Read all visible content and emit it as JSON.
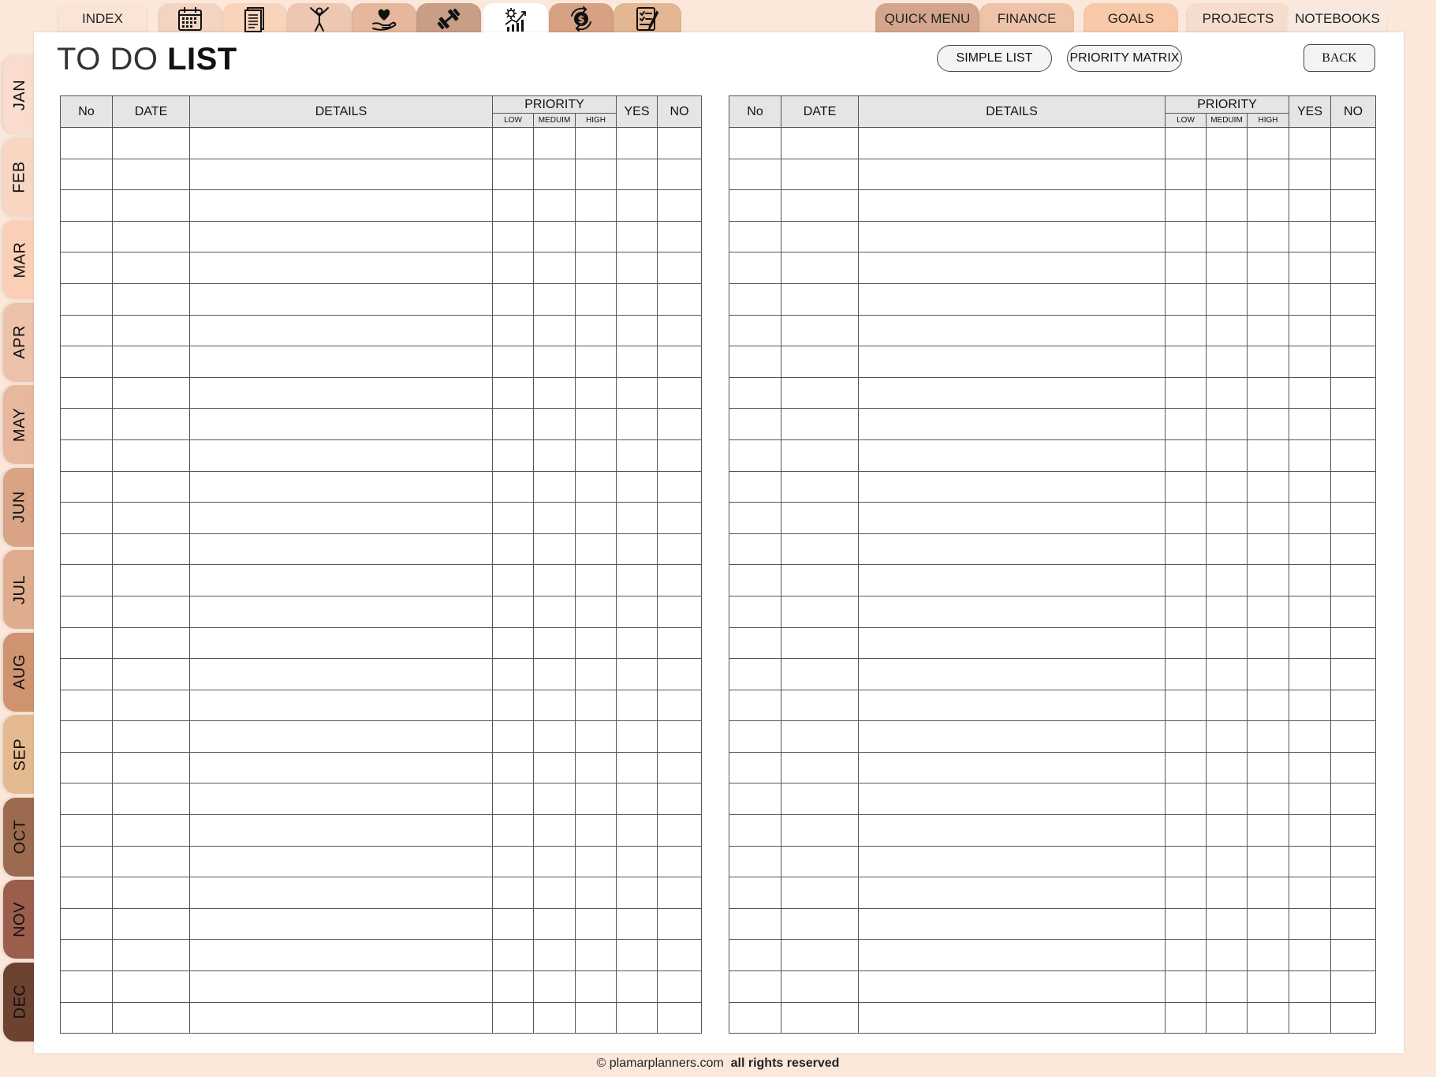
{
  "top_tabs": {
    "index": "INDEX",
    "icons": [
      "calendar-icon",
      "document-icon",
      "person-raising-arms-icon",
      "heart-hand-icon",
      "dumbbell-icon",
      "growth-gear-chart-icon",
      "money-exchange-icon",
      "checklist-icon"
    ],
    "right": {
      "quick_menu": "QUICK MENU",
      "finance": "FINANCE",
      "goals": "GOALS",
      "projects": "PROJECTS",
      "notebooks": "NOTEBOOKS"
    }
  },
  "months": [
    "JAN",
    "FEB",
    "MAR",
    "APR",
    "MAY",
    "JUN",
    "JUL",
    "AUG",
    "SEP",
    "OCT",
    "NOV",
    "DEC"
  ],
  "colors": {
    "months": [
      "#f9dccd",
      "#f8d6c2",
      "#fbcfb5",
      "#edc1aa",
      "#e8b89e",
      "#d9a386",
      "#dfac8d",
      "#cf9370",
      "#e4b98f",
      "#9c6a4f",
      "#9b5e4d",
      "#6e4230"
    ],
    "tabs": [
      "#fae4d6",
      "#f3d4c2",
      "#fad3bb",
      "#edc7b1",
      "#e5b89d",
      "#c99e86",
      "#ffffff",
      "#d6a283",
      "#e3b792"
    ],
    "right_tabs": [
      "#d4a58c",
      "#eec3a8",
      "#f8c9a9",
      "#f5dccd",
      "#f7e9e0"
    ]
  },
  "title": {
    "light": "TO DO ",
    "bold": "LIST"
  },
  "buttons": {
    "simple_list": "SIMPLE LIST",
    "priority_matrix": "PRIORITY MATRIX",
    "back": "BACK"
  },
  "table": {
    "headers": {
      "no": "No",
      "date": "DATE",
      "details": "DETAILS",
      "priority": "PRIORITY",
      "yes": "YES",
      "no_col": "NO"
    },
    "priority_levels": {
      "low": "LOW",
      "medium": "MEDUIM",
      "high": "HIGH"
    },
    "rows": 29
  },
  "footer": {
    "site": "© plamarplanners.com",
    "rights": "all rights reserved"
  }
}
